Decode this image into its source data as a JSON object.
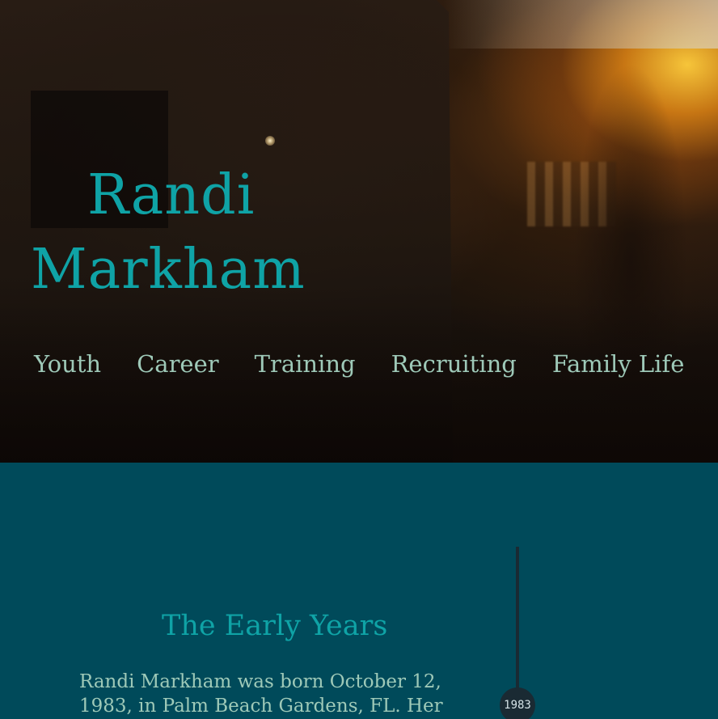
{
  "hero": {
    "title_first": "Randi",
    "title_last": "Markham"
  },
  "nav": {
    "items": [
      {
        "label": "Youth"
      },
      {
        "label": "Career"
      },
      {
        "label": "Training"
      },
      {
        "label": "Recruiting"
      },
      {
        "label": "Family Life"
      }
    ]
  },
  "timeline": {
    "year": "1983"
  },
  "section": {
    "heading": "The Early Years",
    "text": "Randi Markham was born October 12, 1983, in Palm Beach Gardens, FL. Her"
  },
  "colors": {
    "accent": "#0fa3a6",
    "nav_text": "#9ec9b8",
    "content_bg": "#004a5a",
    "timeline": "#1a2a33"
  }
}
